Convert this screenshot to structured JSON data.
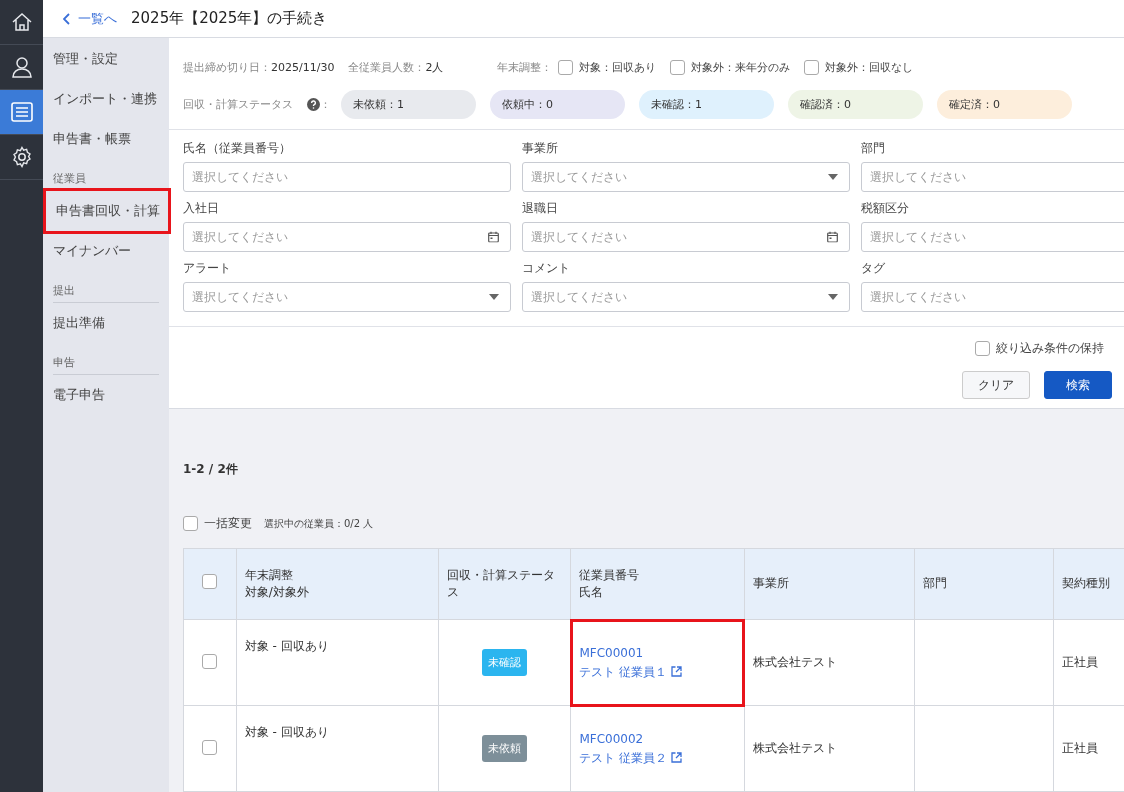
{
  "rail": [
    {
      "selected": false
    },
    {
      "selected": false
    },
    {
      "selected": true
    },
    {
      "selected": false
    }
  ],
  "header": {
    "back": "一覧へ",
    "title": "2025年【2025年】の手続き"
  },
  "sidebar": [
    {
      "kind": "item",
      "label": "管理・設定",
      "highlighted": false
    },
    {
      "kind": "item",
      "label": "インポート・連携",
      "highlighted": false
    },
    {
      "kind": "item",
      "label": "申告書・帳票",
      "highlighted": false
    },
    {
      "kind": "section",
      "label": "従業員"
    },
    {
      "kind": "item",
      "label": "申告書回収・計算",
      "highlighted": true
    },
    {
      "kind": "item",
      "label": "マイナンバー",
      "highlighted": false
    },
    {
      "kind": "section",
      "label": "提出"
    },
    {
      "kind": "item",
      "label": "提出準備",
      "highlighted": false
    },
    {
      "kind": "section",
      "label": "申告"
    },
    {
      "kind": "item",
      "label": "電子申告",
      "highlighted": false
    }
  ],
  "summary": {
    "deadline_label": "提出締め切り日：",
    "deadline": "2025/11/30",
    "count_label": "全従業員人数：",
    "count": "2人",
    "adjust_label": "年末調整：",
    "adjust_options": [
      {
        "label": "対象：回収あり",
        "checked": false
      },
      {
        "label": "対象外：来年分のみ",
        "checked": false
      },
      {
        "label": "対象外：回収なし",
        "checked": false
      }
    ],
    "status_label": "回収・計算ステータス",
    "status_colon": "：",
    "statuses": [
      {
        "label": "未依頼：1",
        "color": "#e8eaee"
      },
      {
        "label": "依頼中：0",
        "color": "#e6e6f5"
      },
      {
        "label": "未確認：1",
        "color": "#dff1fd"
      },
      {
        "label": "確認済：0",
        "color": "#eef4e6"
      },
      {
        "label": "確定済：0",
        "color": "#fdeedc"
      }
    ]
  },
  "filters": [
    {
      "label": "氏名（従業員番号）",
      "kind": "text",
      "placeholder": "選択してください"
    },
    {
      "label": "事業所",
      "kind": "select",
      "placeholder": "選択してください"
    },
    {
      "label": "部門",
      "kind": "text",
      "placeholder": "選択してください"
    },
    {
      "label": "入社日",
      "kind": "date",
      "placeholder": "選択してください"
    },
    {
      "label": "退職日",
      "kind": "date",
      "placeholder": "選択してください"
    },
    {
      "label": "税額区分",
      "kind": "text",
      "placeholder": "選択してください"
    },
    {
      "label": "アラート",
      "kind": "select",
      "placeholder": "選択してください"
    },
    {
      "label": "コメント",
      "kind": "select",
      "placeholder": "選択してください"
    },
    {
      "label": "タグ",
      "kind": "text",
      "placeholder": "選択してください"
    }
  ],
  "keep_filters": {
    "label": "絞り込み条件の保持",
    "checked": false
  },
  "buttons": {
    "clear": "クリア",
    "search": "検索"
  },
  "results": {
    "count": "1-2 / 2件",
    "bulk": {
      "label": "一括変更",
      "checked": false
    },
    "selected_info": "選択中の従業員：0/2 人"
  },
  "table": {
    "header_checked": false,
    "columns": [
      [
        "年末調整",
        "対象/対象外"
      ],
      [
        "回収・計算ステータス"
      ],
      [
        "従業員番号",
        "氏名"
      ],
      [
        "事業所"
      ],
      [
        "部門"
      ],
      [
        "契約種別"
      ]
    ],
    "rows": [
      {
        "checked": false,
        "adjust": "対象 - 回収あり",
        "status": "未確認",
        "color": "#2bb5ef",
        "number": "MFC00001",
        "name": "テスト 従業員１",
        "highlighted": true,
        "office": "株式会社テスト",
        "contract": "正社員"
      },
      {
        "checked": false,
        "adjust": "対象 - 回収あり",
        "status": "未依頼",
        "color": "#7d8f99",
        "number": "MFC00002",
        "name": "テスト 従業員２",
        "highlighted": false,
        "office": "株式会社テスト",
        "contract": "正社員"
      }
    ]
  }
}
